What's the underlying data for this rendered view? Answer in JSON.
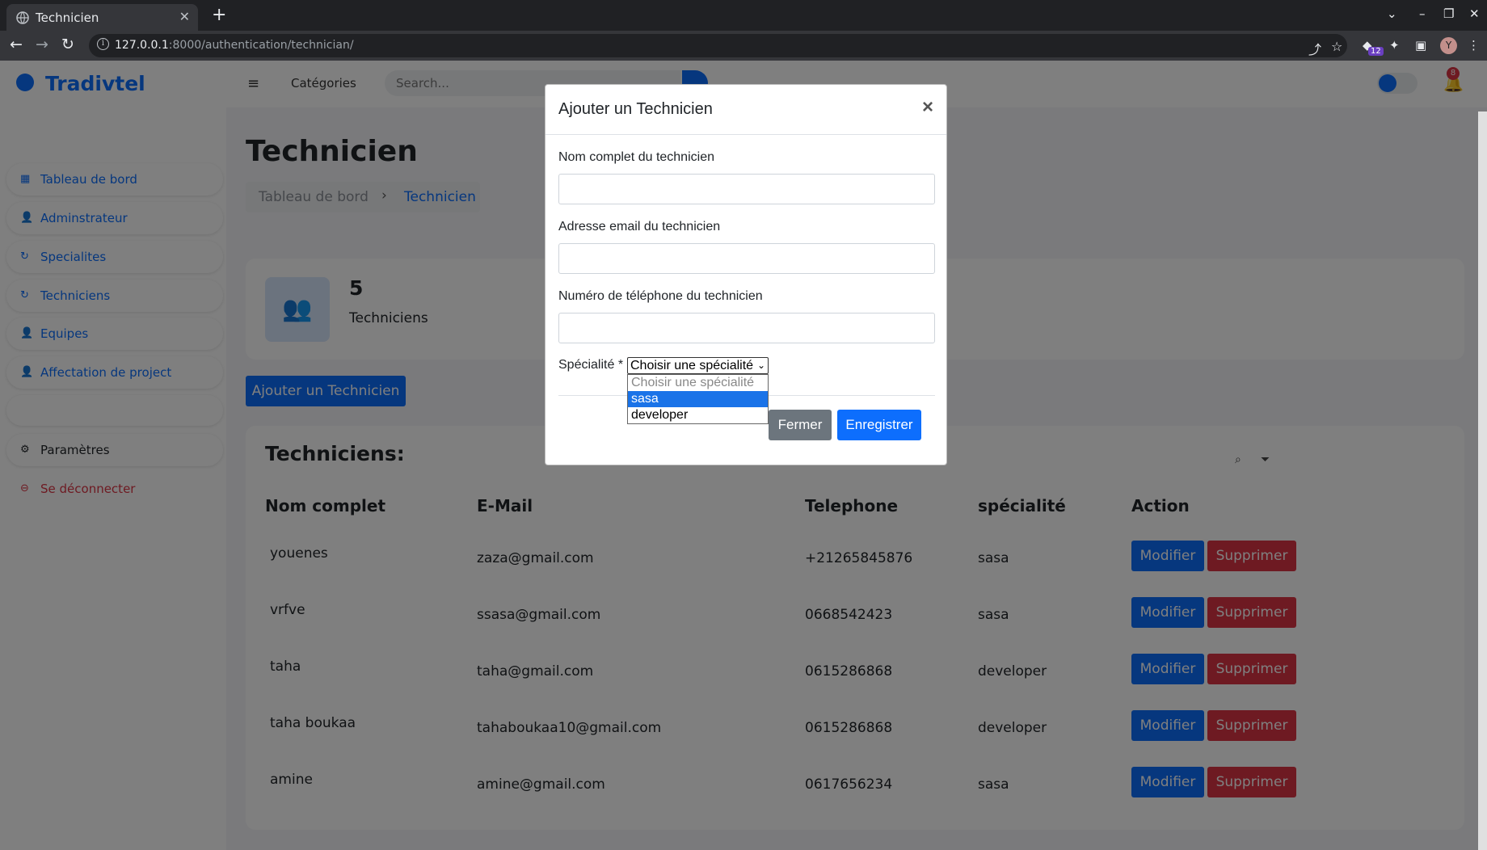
{
  "browser": {
    "tab_title": "Technicien",
    "url_host": "127.0.0.1",
    "url_rest": ":8000/authentication/technician/",
    "extension_badge": "12",
    "profile_initial": "Y"
  },
  "sidebar": {
    "brand": "Tradivtel",
    "items": [
      {
        "label": "Tableau de bord",
        "icon": "grid-icon"
      },
      {
        "label": "Adminstrateur",
        "icon": "users-icon"
      },
      {
        "label": "Specialites",
        "icon": "refresh-icon"
      },
      {
        "label": "Techniciens",
        "icon": "refresh-icon"
      },
      {
        "label": "Equipes",
        "icon": "users-icon"
      },
      {
        "label": "Affectation de project",
        "icon": "users-icon"
      }
    ],
    "settings_label": "Paramètres",
    "logout_label": "Se déconnecter"
  },
  "topbar": {
    "categories_label": "Catégories",
    "search_placeholder": "Search...",
    "notification_count": "8"
  },
  "page": {
    "title": "Technicien",
    "breadcrumb": [
      "Tableau de bord",
      "Technicien"
    ],
    "stat_count": "5",
    "stat_label": "Techniciens",
    "add_button": "Ajouter un Technicien"
  },
  "table": {
    "title": "Techniciens:",
    "headers": [
      "Nom complet",
      "E-Mail",
      "Telephone",
      "spécialité",
      "Action"
    ],
    "rows": [
      {
        "name": "youenes",
        "email": "zaza@gmail.com",
        "phone": "+21265845876",
        "specialty": "sasa"
      },
      {
        "name": "vrfve",
        "email": "ssasa@gmail.com",
        "phone": "0668542423",
        "specialty": "sasa"
      },
      {
        "name": "taha",
        "email": "taha@gmail.com",
        "phone": "0615286868",
        "specialty": "developer"
      },
      {
        "name": "taha boukaa",
        "email": "tahaboukaa10@gmail.com",
        "phone": "0615286868",
        "specialty": "developer"
      },
      {
        "name": "amine",
        "email": "amine@gmail.com",
        "phone": "0617656234",
        "specialty": "sasa"
      }
    ],
    "edit_label": "Modifier",
    "delete_label": "Supprimer"
  },
  "modal": {
    "title": "Ajouter un Technicien",
    "close_glyph": "×",
    "name_label": "Nom complet du technicien",
    "email_label": "Adresse email du technicien",
    "phone_label": "Numéro de téléphone du technicien",
    "specialty_label": "Spécialité *",
    "specialty_selected": "Choisir une spécialité",
    "specialty_options": [
      "Choisir une spécialité",
      "sasa",
      "developer"
    ],
    "highlighted_option": "sasa",
    "close_button": "Fermer",
    "save_button": "Enregistrer"
  },
  "colors": {
    "primary": "#0d6efd",
    "danger": "#dc3545",
    "secondary": "#6c757d"
  }
}
